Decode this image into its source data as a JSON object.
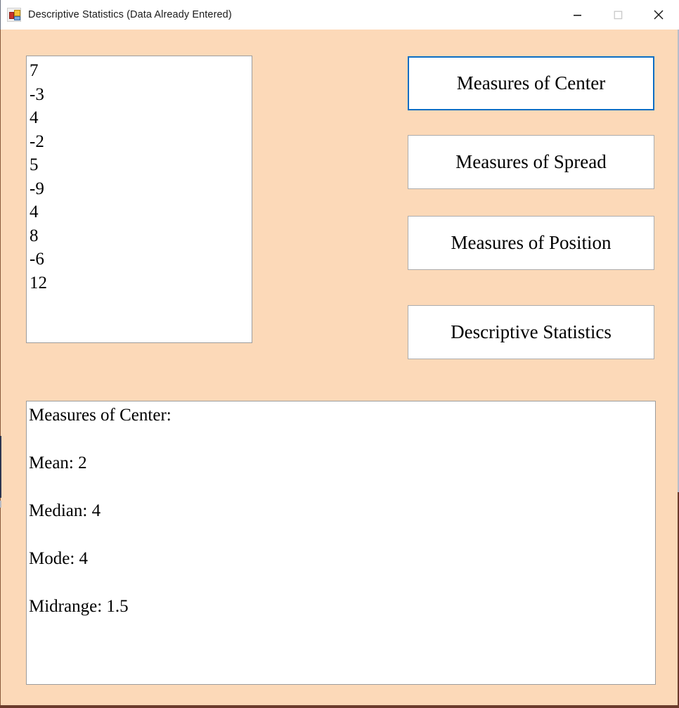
{
  "window": {
    "title": "Descriptive Statistics (Data Already Entered)",
    "icon": "app-window-icon",
    "background_color": "#FCD9B8",
    "titlebar_color": "#FFFFFF",
    "controls": {
      "minimize_label": "Minimize",
      "maximize_label": "Maximize",
      "close_label": "Close"
    }
  },
  "data_listbox": {
    "name": "data-values-listbox",
    "items": [
      "7",
      "-3",
      "4",
      "-2",
      "5",
      "-9",
      "4",
      "8",
      "-6",
      "12"
    ]
  },
  "buttons": [
    {
      "label": "Measures of Center",
      "focused": true,
      "focus_color": "#0A6EC4"
    },
    {
      "label": "Measures of Spread",
      "focused": false
    },
    {
      "label": "Measures of Position",
      "focused": false
    },
    {
      "label": "Descriptive Statistics",
      "focused": false
    }
  ],
  "output": {
    "name": "results-output",
    "lines": [
      "Measures of Center:",
      "",
      "Mean: 2",
      "",
      "Median: 4",
      "",
      "Mode: 4",
      "",
      "Midrange: 1.5"
    ]
  }
}
